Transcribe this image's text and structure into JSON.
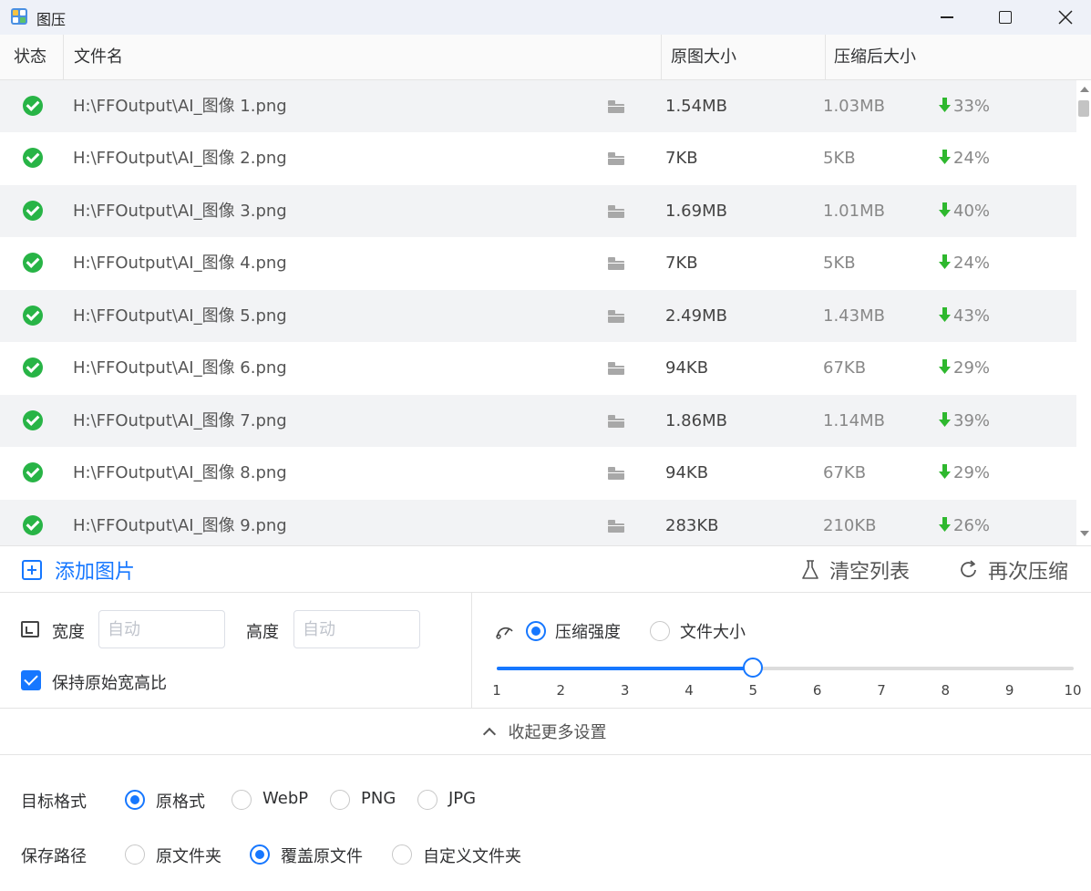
{
  "window": {
    "title": "图压",
    "min_icon": "minimize-icon",
    "max_icon": "maximize-icon",
    "close_icon": "close-icon"
  },
  "table": {
    "headers": {
      "status": "状态",
      "filename": "文件名",
      "original_size": "原图大小",
      "compressed_size": "压缩后大小"
    },
    "rows": [
      {
        "name": "H:\\FFOutput\\AI_图像 1.png",
        "original": "1.54MB",
        "compressed": "1.03MB",
        "reduction": "33%"
      },
      {
        "name": "H:\\FFOutput\\AI_图像 2.png",
        "original": "7KB",
        "compressed": "5KB",
        "reduction": "24%"
      },
      {
        "name": "H:\\FFOutput\\AI_图像 3.png",
        "original": "1.69MB",
        "compressed": "1.01MB",
        "reduction": "40%"
      },
      {
        "name": "H:\\FFOutput\\AI_图像 4.png",
        "original": "7KB",
        "compressed": "5KB",
        "reduction": "24%"
      },
      {
        "name": "H:\\FFOutput\\AI_图像 5.png",
        "original": "2.49MB",
        "compressed": "1.43MB",
        "reduction": "43%"
      },
      {
        "name": "H:\\FFOutput\\AI_图像 6.png",
        "original": "94KB",
        "compressed": "67KB",
        "reduction": "29%"
      },
      {
        "name": "H:\\FFOutput\\AI_图像 7.png",
        "original": "1.86MB",
        "compressed": "1.14MB",
        "reduction": "39%"
      },
      {
        "name": "H:\\FFOutput\\AI_图像 8.png",
        "original": "94KB",
        "compressed": "67KB",
        "reduction": "29%"
      },
      {
        "name": "H:\\FFOutput\\AI_图像 9.png",
        "original": "283KB",
        "compressed": "210KB",
        "reduction": "26%"
      }
    ]
  },
  "actions": {
    "add_images": "添加图片",
    "clear_list": "清空列表",
    "recompress": "再次压缩"
  },
  "resize": {
    "width_label": "宽度",
    "width_placeholder": "自动",
    "height_label": "高度",
    "height_placeholder": "自动",
    "keep_ratio_label": "保持原始宽高比",
    "keep_ratio_checked": true
  },
  "compression": {
    "mode_strength_label": "压缩强度",
    "mode_filesize_label": "文件大小",
    "selected_mode": "strength",
    "slider_value": 5,
    "slider_ticks": [
      "1",
      "2",
      "3",
      "4",
      "5",
      "6",
      "7",
      "8",
      "9",
      "10"
    ]
  },
  "collapse_label": "收起更多设置",
  "target_format": {
    "label": "目标格式",
    "options": [
      "原格式",
      "WebP",
      "PNG",
      "JPG"
    ],
    "selected": "原格式"
  },
  "save_path": {
    "label": "保存路径",
    "options": [
      "原文件夹",
      "覆盖原文件",
      "自定义文件夹"
    ],
    "selected": "覆盖原文件"
  },
  "colors": {
    "accent": "#1677ff",
    "success": "#28b446",
    "down_arrow": "#2eb82e"
  }
}
